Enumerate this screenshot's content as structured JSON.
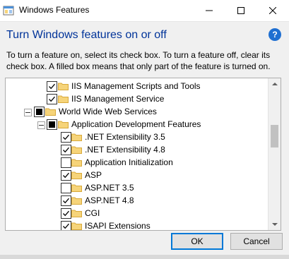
{
  "window": {
    "title": "Windows Features",
    "controls": [
      "minimize-icon",
      "maximize-icon",
      "close-icon"
    ]
  },
  "header": {
    "heading": "Turn Windows features on or off",
    "help_icon_char": "?",
    "description": "To turn a feature on, select its check box. To turn a feature off, clear its check box. A filled box means that only part of the feature is turned on."
  },
  "tree": {
    "items": [
      {
        "label": "IIS Management Scripts and Tools",
        "state": "checked",
        "expander": false
      },
      {
        "label": "IIS Management Service",
        "state": "checked",
        "expander": false
      },
      {
        "label": "World Wide Web Services",
        "state": "partial",
        "expander": true
      },
      {
        "label": "Application Development Features",
        "state": "partial",
        "expander": true
      },
      {
        "label": ".NET Extensibility 3.5",
        "state": "checked",
        "expander": false
      },
      {
        "label": ".NET Extensibility 4.8",
        "state": "checked",
        "expander": false
      },
      {
        "label": "Application Initialization",
        "state": "unchecked",
        "expander": false
      },
      {
        "label": "ASP",
        "state": "checked",
        "expander": false
      },
      {
        "label": "ASP.NET 3.5",
        "state": "unchecked",
        "expander": false
      },
      {
        "label": "ASP.NET 4.8",
        "state": "checked",
        "expander": false
      },
      {
        "label": "CGI",
        "state": "checked",
        "expander": false
      },
      {
        "label": "ISAPI Extensions",
        "state": "checked",
        "expander": false
      }
    ]
  },
  "buttons": {
    "ok": "OK",
    "cancel": "Cancel"
  },
  "colors": {
    "heading": "#003399",
    "folder": "#f6d47a",
    "help": "#1f6fd1",
    "focus": "#0078d7"
  }
}
